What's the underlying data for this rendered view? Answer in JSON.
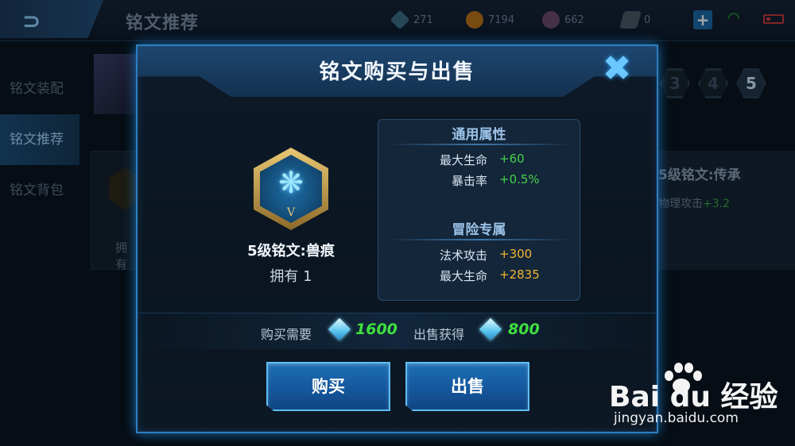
{
  "top_bar": {
    "page_title": "铭文推荐",
    "resources": {
      "crystal": "271",
      "gold": "7194",
      "gem": "662",
      "ticket": "0"
    },
    "add_symbol": "+"
  },
  "left_nav": {
    "items": [
      {
        "label": "铭文装配"
      },
      {
        "label": "铭文推荐"
      },
      {
        "label": "铭文背包"
      }
    ]
  },
  "background": {
    "levels": [
      "3",
      "4",
      "5"
    ],
    "card_owned": "拥有",
    "right_card_title": "5级铭文:传承",
    "right_card_stat_label": "物理攻击",
    "right_card_stat_value": "+3.2"
  },
  "modal": {
    "title": "铭文购买与出售",
    "close_symbol": "✖",
    "item": {
      "emblem_rank": "V",
      "name": "5级铭文:兽痕",
      "owned": "拥有 1"
    },
    "attributes": {
      "general_title": "通用属性",
      "general": [
        {
          "label": "最大生命",
          "value": "+60"
        },
        {
          "label": "暴击率",
          "value": "+0.5%"
        }
      ],
      "adventure_title": "冒险专属",
      "adventure": [
        {
          "label": "法术攻击",
          "value": "+300"
        },
        {
          "label": "最大生命",
          "value": "+2835"
        }
      ]
    },
    "price": {
      "buy_label": "购买需要",
      "buy_value": "1600",
      "sell_label": "出售获得",
      "sell_value": "800"
    },
    "buttons": {
      "buy": "购买",
      "sell": "出售"
    }
  },
  "watermark": {
    "brand": "Bai du 经验",
    "url": "jingyan.baidu.com"
  },
  "colors": {
    "accent": "#2d7fc2",
    "green_value": "#46d14a",
    "gold_value": "#f2b632",
    "price_green": "#3fe03f"
  }
}
